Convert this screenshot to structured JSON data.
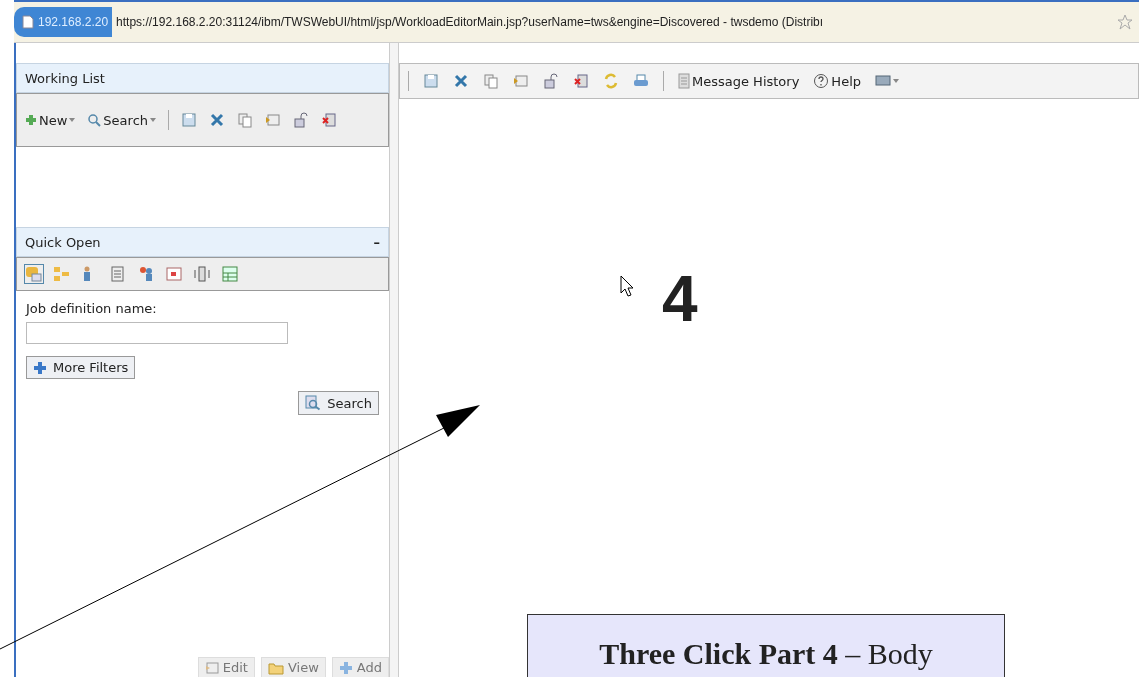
{
  "address_bar": {
    "host": "192.168.2.20",
    "url": "https://192.168.2.20:31124/ibm/TWSWebUI/html/jsp/WorkloadEditorMain.jsp?userName=tws&engine=Discovered - twsdemo (Distribı"
  },
  "working_list": {
    "title": "Working List",
    "new_label": "New",
    "search_label": "Search"
  },
  "quick_open": {
    "title": "Quick Open",
    "collapse": "–",
    "field_label": "Job definition name:",
    "more_filters": "More Filters",
    "search_button": "Search",
    "bottom_buttons": [
      {
        "label": "Edit",
        "disabled": true
      },
      {
        "label": "View",
        "disabled": true
      },
      {
        "label": "Add",
        "disabled": true
      }
    ]
  },
  "editor_toolbar": {
    "message_history": "Message History",
    "help": "Help"
  },
  "annotation": {
    "step": "4",
    "caption": "**Three Click Part 4** – Body"
  }
}
